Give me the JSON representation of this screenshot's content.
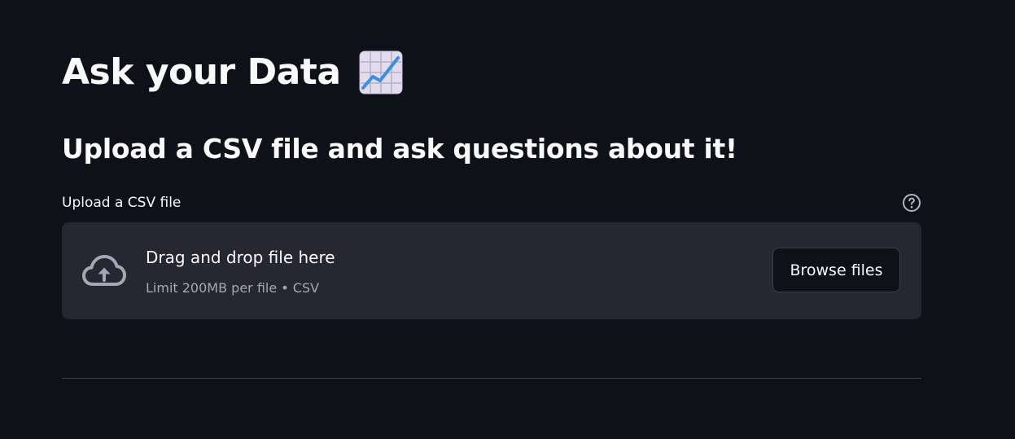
{
  "header": {
    "title": "Ask your Data",
    "title_icon": "chart-increasing-emoji",
    "subtitle": "Upload a CSV file and ask questions about it!"
  },
  "uploader": {
    "label": "Upload a CSV file",
    "help_icon": "question-circle-icon",
    "cloud_icon": "cloud-upload-icon",
    "instructions": "Drag and drop file here",
    "limit": "Limit 200MB per file • CSV",
    "browse_label": "Browse files"
  },
  "colors": {
    "background": "#0e1117",
    "dropzone": "#262730",
    "text": "#fafafa",
    "muted_text": "#a3a8b8",
    "accent_line": "#3b8ee6"
  }
}
